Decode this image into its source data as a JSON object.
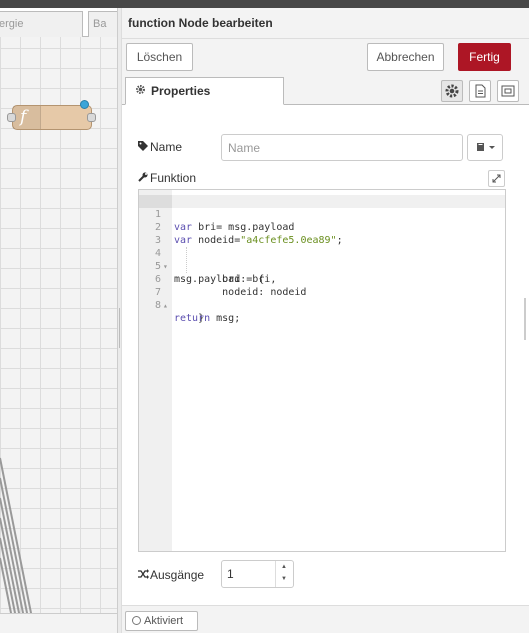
{
  "workspace": {
    "tabs": [
      "ergie",
      "Ba"
    ],
    "node_icon": "f"
  },
  "tray": {
    "title": "function Node bearbeiten",
    "toolbar": {
      "delete_label": "Löschen",
      "cancel_label": "Abbrechen",
      "done_label": "Fertig"
    },
    "tabs": {
      "properties_label": "Properties"
    },
    "form": {
      "name_label": "Name",
      "name_placeholder": "Name",
      "name_value": "",
      "function_label": "Funktion",
      "outputs_label": "Ausgänge",
      "outputs_value": "1"
    },
    "code": {
      "line_numbers": [
        "1",
        "2",
        "3",
        "4",
        "5",
        "6",
        "7",
        "8"
      ],
      "fold_markers": {
        "4": "▾",
        "7": "▴"
      }
    },
    "footer": {
      "enabled_label": "Aktiviert"
    }
  },
  "colors": {
    "accent": "#ad1625",
    "node_fill": "#e6c9a8",
    "status_dot": "#3ba5d9",
    "keyword": "#5c4fb0",
    "string": "#6a8f1f"
  },
  "icons": {
    "tab": "gear-icon",
    "name": "tag-icon",
    "function": "wrench-icon",
    "outputs": "shuffle-icon",
    "library": "book-icon",
    "expand": "expand-icon"
  }
}
